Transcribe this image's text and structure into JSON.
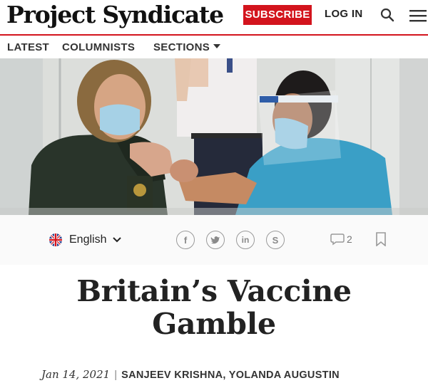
{
  "header": {
    "logo": "Project Syndicate",
    "subscribe_label": "SUBSCRIBE",
    "login_label": "LOG IN",
    "search_icon": "search-icon",
    "menu_icon": "hamburger-menu-icon",
    "accent_color": "#d3141d"
  },
  "nav": {
    "items": [
      {
        "label": "LATEST"
      },
      {
        "label": "COLUMNISTS"
      },
      {
        "label": "SECTIONS",
        "has_dropdown": true
      }
    ]
  },
  "share_bar": {
    "language": "English",
    "language_flag": "uk-flag-icon",
    "social_icons": [
      "facebook-icon",
      "twitter-icon",
      "linkedin-icon",
      "skype-icon"
    ],
    "comment_count": "2",
    "bookmark_icon": "bookmark-icon"
  },
  "article": {
    "title_line1": "Britain’s Vaccine",
    "title_line2": "Gamble",
    "date": "Jan 14, 2021",
    "separator": "|",
    "authors": "SANJEEV KRISHNA, YOLANDA AUGUSTIN"
  }
}
